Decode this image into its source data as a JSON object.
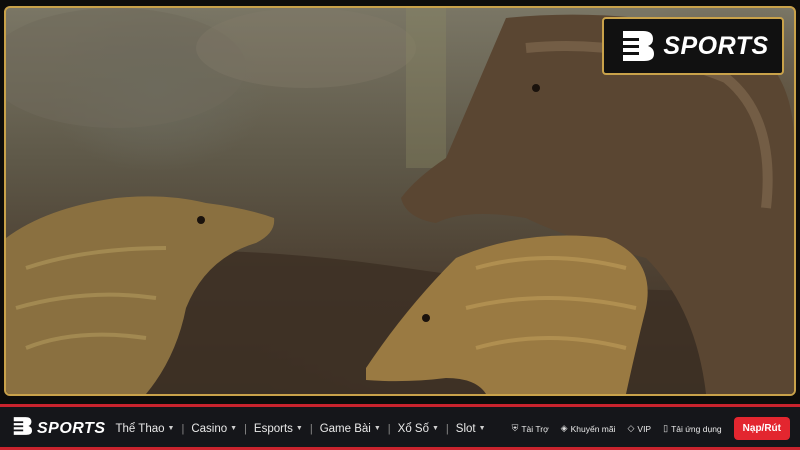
{
  "brand": {
    "name": "SPORTS",
    "accent": "#c9a24a",
    "red": "#e3262f"
  },
  "nav": {
    "items": [
      {
        "label": "Thể Thao",
        "icon": "caret-down-icon"
      },
      {
        "label": "Casino",
        "icon": "caret-down-icon"
      },
      {
        "label": "Esports",
        "icon": "caret-down-icon"
      },
      {
        "label": "Game Bài",
        "icon": "caret-down-icon"
      },
      {
        "label": "Xổ Số",
        "icon": "caret-down-icon"
      },
      {
        "label": "Slot",
        "icon": "caret-down-icon"
      }
    ],
    "separator": "|",
    "utilities": [
      {
        "label": "Tài Trợ",
        "icon": "shield-icon"
      },
      {
        "label": "Khuyến mãi",
        "icon": "tag-icon"
      },
      {
        "label": "VIP",
        "icon": "diamond-icon"
      },
      {
        "label": "Tải ứng dụng",
        "icon": "phone-icon"
      }
    ],
    "cta_label": "Nạp/Rút"
  }
}
